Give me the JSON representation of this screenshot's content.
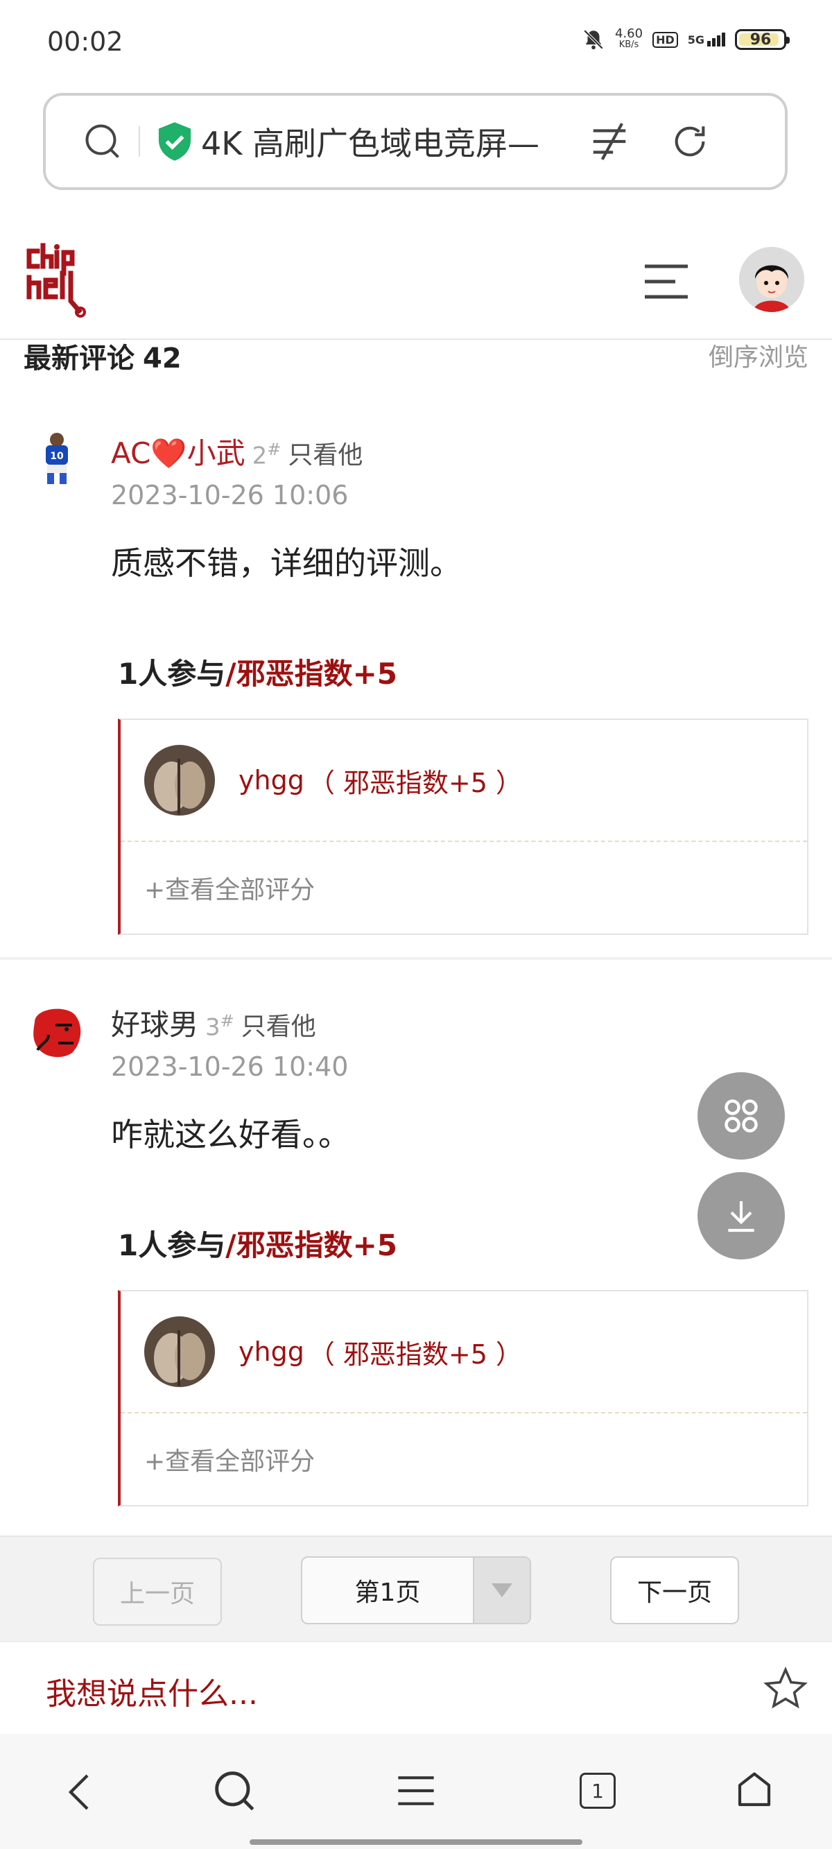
{
  "status": {
    "time": "00:02",
    "net_speed_top": "4.60",
    "net_speed_unit": "KB/s",
    "hd": "HD",
    "network": "5G",
    "battery": "96"
  },
  "urlbar": {
    "title": "4K 高刷广色域电竞屏—"
  },
  "header": {
    "logo": "chiphell"
  },
  "comments_section": {
    "title": "最新评论",
    "count": "42",
    "reverse": "倒序浏览"
  },
  "comments": [
    {
      "author": "AC❤️小武",
      "floor": "2",
      "floor_mark": "#",
      "only_him": "只看他",
      "time": "2023-10-26 10:06",
      "text": "质感不错，详细的评测。",
      "rate_count": "1人参与",
      "rate_title": "/邪恶指数+5",
      "rate_user": "yhgg",
      "rate_detail": "（ 邪恶指数+5 ）",
      "rate_more": "+查看全部评分"
    },
    {
      "author": "好球男",
      "floor": "3",
      "floor_mark": "#",
      "only_him": "只看他",
      "time": "2023-10-26 10:40",
      "text": "咋就这么好看。。",
      "rate_count": "1人参与",
      "rate_title": "/邪恶指数+5",
      "rate_user": "yhgg",
      "rate_detail": "（ 邪恶指数+5 ）",
      "rate_more": "+查看全部评分"
    }
  ],
  "pager": {
    "prev": "上一页",
    "current": "第1页",
    "next": "下一页"
  },
  "reply": {
    "placeholder": "我想说点什么..."
  },
  "bottom_nav": {
    "tabs_count": "1"
  },
  "colors": {
    "brand": "#9e1010",
    "accent_border": "#b01e23"
  }
}
